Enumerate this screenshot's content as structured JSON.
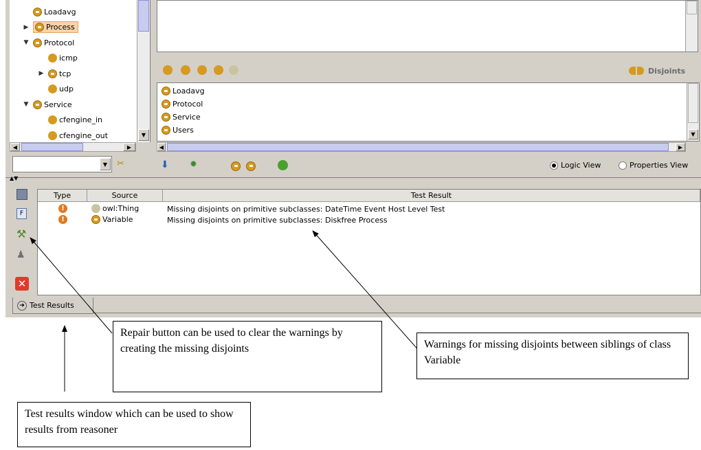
{
  "class_tree": {
    "items": [
      {
        "label": "Loadavg",
        "expander": "",
        "level": 1,
        "selected": false
      },
      {
        "label": "Process",
        "expander": "▶",
        "level": 1,
        "selected": true
      },
      {
        "label": "Protocol",
        "expander": "▼",
        "level": 1,
        "selected": false
      },
      {
        "label": "icmp",
        "expander": "",
        "level": 2,
        "selected": false
      },
      {
        "label": "tcp",
        "expander": "▶",
        "level": 2,
        "selected": false
      },
      {
        "label": "udp",
        "expander": "",
        "level": 2,
        "selected": false
      },
      {
        "label": "Service",
        "expander": "▼",
        "level": 1,
        "selected": false
      },
      {
        "label": "cfengine_in",
        "expander": "",
        "level": 2,
        "selected": false
      },
      {
        "label": "cfengine_out",
        "expander": "",
        "level": 2,
        "selected": false
      }
    ]
  },
  "disjoints": {
    "header_label": "Disjoints",
    "items": [
      "Loadavg",
      "Protocol",
      "Service",
      "Users"
    ]
  },
  "view_toggle": {
    "logic_label": "Logic View",
    "properties_label": "Properties View",
    "selected": "logic"
  },
  "test_table": {
    "headers": {
      "type": "Type",
      "source": "Source",
      "result": "Test Result"
    },
    "rows": [
      {
        "source": "owl:Thing",
        "result": "Missing disjoints on primitive subclasses: DateTime Event Host Level Test"
      },
      {
        "source": "Variable",
        "result": "Missing disjoints on primitive subclasses: Diskfree Process"
      }
    ]
  },
  "bottom_tab": {
    "label": "Test Results"
  },
  "callouts": {
    "repair": "Repair button can be used to clear the warnings by creating the missing disjoints",
    "warnings": "Warnings for missing disjoints between siblings of class Variable",
    "test_window": "Test results window which can be used to show results from reasoner"
  },
  "colors": {
    "class_icon": "#d59a1f",
    "selection": "#f8d3a8",
    "warning": "#e07a1f",
    "error_button": "#e03c2c"
  }
}
